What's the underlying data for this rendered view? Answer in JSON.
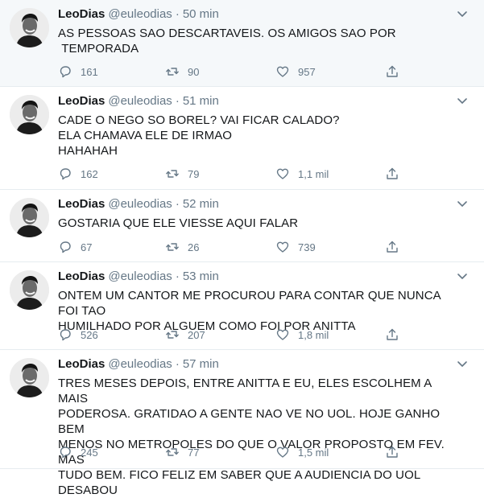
{
  "tweets": [
    {
      "name": "LeoDias",
      "handle": "@euleodias",
      "dot": "·",
      "time": "50 min",
      "text": "AS PESSOAS SAO DESCARTAVEIS. OS AMIGOS SAO POR\n TEMPORADA",
      "replies": "161",
      "retweets": "90",
      "likes": "957"
    },
    {
      "name": "LeoDias",
      "handle": "@euleodias",
      "dot": "·",
      "time": "51 min",
      "text": "CADE O NEGO SO BOREL? VAI FICAR CALADO?\nELA CHAMAVA ELE DE IRMAO\nHAHAHAH",
      "replies": "162",
      "retweets": "79",
      "likes": "1,1 mil"
    },
    {
      "name": "LeoDias",
      "handle": "@euleodias",
      "dot": "·",
      "time": "52 min",
      "text": "GOSTARIA QUE ELE VIESSE AQUI FALAR",
      "replies": "67",
      "retweets": "26",
      "likes": "739"
    },
    {
      "name": "LeoDias",
      "handle": "@euleodias",
      "dot": "·",
      "time": "53 min",
      "text": "ONTEM UM CANTOR ME PROCUROU PARA CONTAR QUE NUNCA FOI TAO\nHUMILHADO POR ALGUEM COMO FOI POR ANITTA",
      "replies": "526",
      "retweets": "207",
      "likes": "1,8 mil"
    },
    {
      "name": "LeoDias",
      "handle": "@euleodias",
      "dot": "·",
      "time": "57 min",
      "text": "TRES MESES DEPOIS, ENTRE ANITTA E EU, ELES ESCOLHEM A MAIS\nPODEROSA. GRATIDAO A GENTE NAO VE NO UOL. HOJE GANHO BEM\nMENOS NO METROPOLES DO QUE O VALOR PROPOSTO EM FEV. MAS\nTUDO BEM. FICO FELIZ EM SABER QUE A AUDIENCIA DO UOL DESABOU",
      "replies": "245",
      "retweets": "77",
      "likes": "1,5 mil"
    }
  ],
  "colors": {
    "text": "#14171a",
    "secondary": "#657786",
    "border": "#e6ecf0"
  },
  "icons": {
    "reply": "reply-icon",
    "retweet": "retweet-icon",
    "like": "heart-icon",
    "share": "share-icon",
    "caret": "chevron-down-icon"
  }
}
